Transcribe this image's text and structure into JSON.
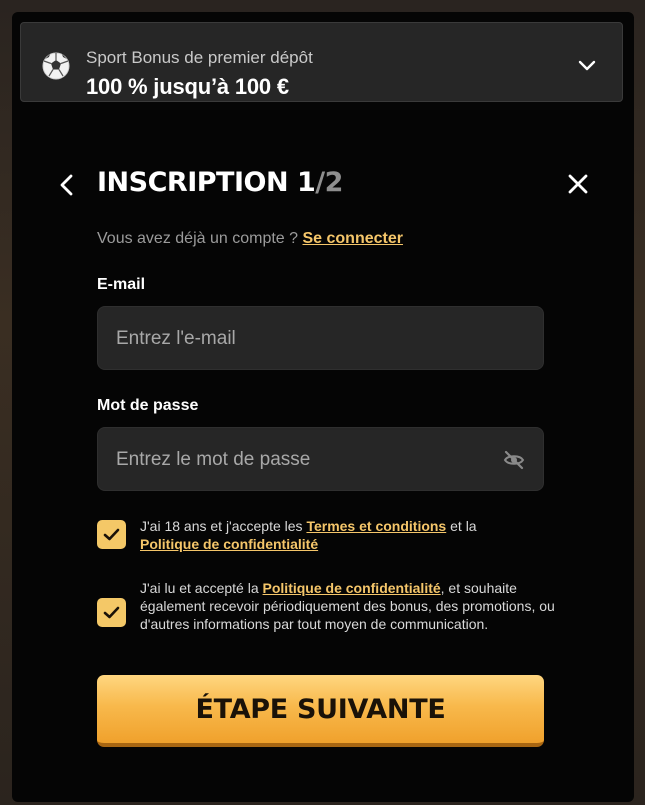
{
  "bonus": {
    "subtitle": "Sport Bonus de premier dépôt",
    "title": "100 % jusqu’à 100 €",
    "icon": "soccer-ball-icon"
  },
  "header": {
    "title_main": "INSCRIPTION 1",
    "title_rest": "/2"
  },
  "login_prompt": {
    "text": "Vous avez déjà un compte ?",
    "link": "Se connecter"
  },
  "email": {
    "label": "E-mail",
    "placeholder": "Entrez l'e-mail",
    "value": ""
  },
  "password": {
    "label": "Mot de passe",
    "placeholder": "Entrez le mot de passe",
    "value": ""
  },
  "consent1": {
    "checked": true,
    "text_a": "J'ai 18 ans et j'accepte les ",
    "link_terms": "Termes et conditions",
    "text_b": " et la ",
    "link_privacy": "Politique de confidentialité"
  },
  "consent2": {
    "checked": true,
    "text_a": "J'ai lu et accepté la ",
    "link_privacy": "Politique de confidentialité",
    "text_b": ", et souhaite également recevoir périodiquement des bonus, des promotions, ou d'autres informations par tout moyen de communication."
  },
  "cta": {
    "label": "ÉTAPE SUIVANTE"
  },
  "colors": {
    "accent": "#f5c66a",
    "button": "#f8b94c",
    "panel": "#050505",
    "field": "#262626"
  }
}
